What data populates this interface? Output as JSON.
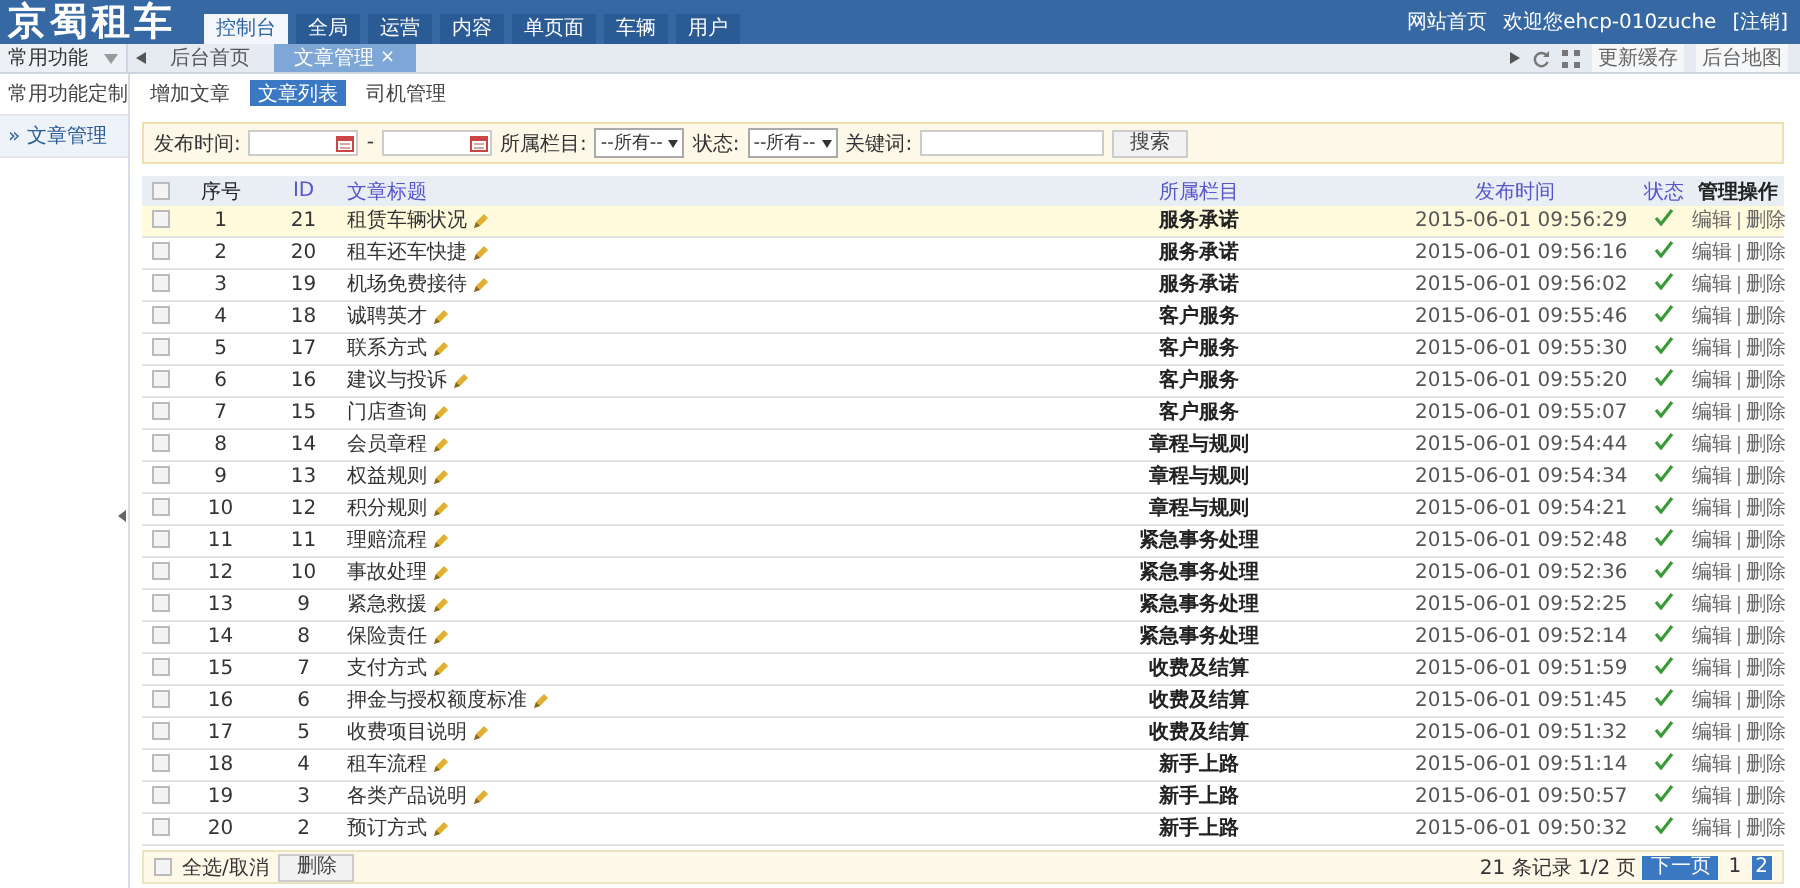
{
  "header": {
    "logo": "京蜀租车",
    "nav": [
      {
        "label": "控制台",
        "selected": true
      },
      {
        "label": "全局",
        "selected": false
      },
      {
        "label": "运营",
        "selected": false
      },
      {
        "label": "内容",
        "selected": false
      },
      {
        "label": "单页面",
        "selected": false
      },
      {
        "label": "车辆",
        "selected": false
      },
      {
        "label": "用户",
        "selected": false
      }
    ],
    "links": [
      "网站首页",
      "欢迎您ehcp-010zuche",
      "[注销]"
    ]
  },
  "sidebar": {
    "title": "常用功能",
    "items": [
      {
        "label": "常用功能定制",
        "selected": false
      },
      {
        "label": "» 文章管理",
        "selected": true
      }
    ]
  },
  "tab_bar": {
    "tabs": [
      {
        "label": "后台首页",
        "selected": false,
        "closable": false
      },
      {
        "label": "文章管理",
        "selected": true,
        "closable": true
      }
    ],
    "close_glyph": "×",
    "actions": [
      "更新缓存",
      "后台地图"
    ]
  },
  "sub_tabs": [
    {
      "label": "增加文章",
      "selected": false
    },
    {
      "label": "文章列表",
      "selected": true
    },
    {
      "label": "司机管理",
      "selected": false
    }
  ],
  "filter": {
    "date_label": "发布时间:",
    "date_separator": "-",
    "category_label": "所属栏目:",
    "category_value": "--所有--",
    "status_label": "状态:",
    "status_value": "--所有--",
    "keyword_label": "关键词:",
    "search_button": "搜索"
  },
  "table": {
    "columns": [
      "序号",
      "ID",
      "文章标题",
      "所属栏目",
      "发布时间",
      "状态",
      "管理操作"
    ],
    "header_checked": false,
    "rows": [
      {
        "checked": false,
        "no": "1",
        "id": "21",
        "title": "租赁车辆状况",
        "category": "服务承诺",
        "time": "2015-06-01 09:56:29",
        "published": true,
        "highlighted": true,
        "edit": "编辑",
        "delete": "删除"
      },
      {
        "checked": false,
        "no": "2",
        "id": "20",
        "title": "租车还车快捷",
        "category": "服务承诺",
        "time": "2015-06-01 09:56:16",
        "published": true,
        "highlighted": false,
        "edit": "编辑",
        "delete": "删除"
      },
      {
        "checked": false,
        "no": "3",
        "id": "19",
        "title": "机场免费接待",
        "category": "服务承诺",
        "time": "2015-06-01 09:56:02",
        "published": true,
        "highlighted": false,
        "edit": "编辑",
        "delete": "删除"
      },
      {
        "checked": false,
        "no": "4",
        "id": "18",
        "title": "诚聘英才",
        "category": "客户服务",
        "time": "2015-06-01 09:55:46",
        "published": true,
        "highlighted": false,
        "edit": "编辑",
        "delete": "删除"
      },
      {
        "checked": false,
        "no": "5",
        "id": "17",
        "title": "联系方式",
        "category": "客户服务",
        "time": "2015-06-01 09:55:30",
        "published": true,
        "highlighted": false,
        "edit": "编辑",
        "delete": "删除"
      },
      {
        "checked": false,
        "no": "6",
        "id": "16",
        "title": "建议与投诉",
        "category": "客户服务",
        "time": "2015-06-01 09:55:20",
        "published": true,
        "highlighted": false,
        "edit": "编辑",
        "delete": "删除"
      },
      {
        "checked": false,
        "no": "7",
        "id": "15",
        "title": "门店查询",
        "category": "客户服务",
        "time": "2015-06-01 09:55:07",
        "published": true,
        "highlighted": false,
        "edit": "编辑",
        "delete": "删除"
      },
      {
        "checked": false,
        "no": "8",
        "id": "14",
        "title": "会员章程",
        "category": "章程与规则",
        "time": "2015-06-01 09:54:44",
        "published": true,
        "highlighted": false,
        "edit": "编辑",
        "delete": "删除"
      },
      {
        "checked": false,
        "no": "9",
        "id": "13",
        "title": "权益规则",
        "category": "章程与规则",
        "time": "2015-06-01 09:54:34",
        "published": true,
        "highlighted": false,
        "edit": "编辑",
        "delete": "删除"
      },
      {
        "checked": false,
        "no": "10",
        "id": "12",
        "title": "积分规则",
        "category": "章程与规则",
        "time": "2015-06-01 09:54:21",
        "published": true,
        "highlighted": false,
        "edit": "编辑",
        "delete": "删除"
      },
      {
        "checked": false,
        "no": "11",
        "id": "11",
        "title": "理赔流程",
        "category": "紧急事务处理",
        "time": "2015-06-01 09:52:48",
        "published": true,
        "highlighted": false,
        "edit": "编辑",
        "delete": "删除"
      },
      {
        "checked": false,
        "no": "12",
        "id": "10",
        "title": "事故处理",
        "category": "紧急事务处理",
        "time": "2015-06-01 09:52:36",
        "published": true,
        "highlighted": false,
        "edit": "编辑",
        "delete": "删除"
      },
      {
        "checked": false,
        "no": "13",
        "id": "9",
        "title": "紧急救援",
        "category": "紧急事务处理",
        "time": "2015-06-01 09:52:25",
        "published": true,
        "highlighted": false,
        "edit": "编辑",
        "delete": "删除"
      },
      {
        "checked": false,
        "no": "14",
        "id": "8",
        "title": "保险责任",
        "category": "紧急事务处理",
        "time": "2015-06-01 09:52:14",
        "published": true,
        "highlighted": false,
        "edit": "编辑",
        "delete": "删除"
      },
      {
        "checked": false,
        "no": "15",
        "id": "7",
        "title": "支付方式",
        "category": "收费及结算",
        "time": "2015-06-01 09:51:59",
        "published": true,
        "highlighted": false,
        "edit": "编辑",
        "delete": "删除"
      },
      {
        "checked": false,
        "no": "16",
        "id": "6",
        "title": "押金与授权额度标准",
        "category": "收费及结算",
        "time": "2015-06-01 09:51:45",
        "published": true,
        "highlighted": false,
        "edit": "编辑",
        "delete": "删除"
      },
      {
        "checked": false,
        "no": "17",
        "id": "5",
        "title": "收费项目说明",
        "category": "收费及结算",
        "time": "2015-06-01 09:51:32",
        "published": true,
        "highlighted": false,
        "edit": "编辑",
        "delete": "删除"
      },
      {
        "checked": false,
        "no": "18",
        "id": "4",
        "title": "租车流程",
        "category": "新手上路",
        "time": "2015-06-01 09:51:14",
        "published": true,
        "highlighted": false,
        "edit": "编辑",
        "delete": "删除"
      },
      {
        "checked": false,
        "no": "19",
        "id": "3",
        "title": "各类产品说明",
        "category": "新手上路",
        "time": "2015-06-01 09:50:57",
        "published": true,
        "highlighted": false,
        "edit": "编辑",
        "delete": "删除"
      },
      {
        "checked": false,
        "no": "20",
        "id": "2",
        "title": "预订方式",
        "category": "新手上路",
        "time": "2015-06-01 09:50:32",
        "published": true,
        "highlighted": false,
        "edit": "编辑",
        "delete": "删除"
      }
    ]
  },
  "footer": {
    "select_all_checked": false,
    "select_all": "全选/取消",
    "delete_button": "删除",
    "summary": "21 条记录 1/2 页",
    "next_button": "下一页",
    "pages": [
      {
        "label": "1",
        "selected": false
      },
      {
        "label": "2",
        "selected": true
      }
    ]
  }
}
